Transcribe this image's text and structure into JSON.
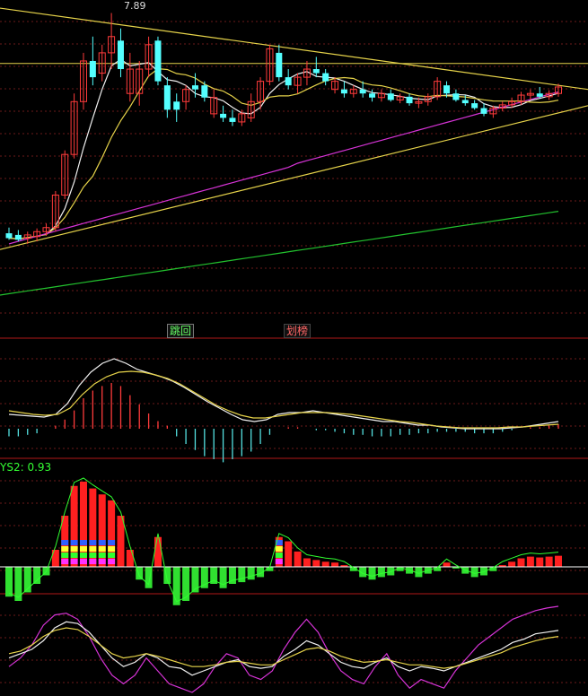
{
  "chart_data": {
    "type": "candlestick",
    "price_label": "7.89",
    "tags": [
      {
        "text": "跳回",
        "color": "#66ff66"
      },
      {
        "text": "划榜",
        "color": "#ff6666"
      }
    ],
    "ys2": {
      "label": "YS2: 0.93",
      "value": 0.93
    },
    "candles": [
      {
        "o": 5.18,
        "h": 5.25,
        "l": 5.1,
        "c": 5.12,
        "up": false
      },
      {
        "o": 5.16,
        "h": 5.22,
        "l": 5.08,
        "c": 5.1,
        "up": false
      },
      {
        "o": 5.12,
        "h": 5.2,
        "l": 5.05,
        "c": 5.16,
        "up": true
      },
      {
        "o": 5.14,
        "h": 5.24,
        "l": 5.08,
        "c": 5.2,
        "up": true
      },
      {
        "o": 5.2,
        "h": 5.3,
        "l": 5.15,
        "c": 5.25,
        "up": true
      },
      {
        "o": 5.25,
        "h": 5.7,
        "l": 5.2,
        "c": 5.65,
        "up": true
      },
      {
        "o": 5.65,
        "h": 6.2,
        "l": 5.6,
        "c": 6.15,
        "up": true
      },
      {
        "o": 6.15,
        "h": 6.9,
        "l": 6.1,
        "c": 6.8,
        "up": true
      },
      {
        "o": 6.8,
        "h": 7.4,
        "l": 6.7,
        "c": 7.3,
        "up": true
      },
      {
        "o": 7.3,
        "h": 7.6,
        "l": 7.0,
        "c": 7.1,
        "up": false
      },
      {
        "o": 7.15,
        "h": 7.5,
        "l": 7.05,
        "c": 7.4,
        "up": true
      },
      {
        "o": 7.4,
        "h": 7.89,
        "l": 7.2,
        "c": 7.6,
        "up": true
      },
      {
        "o": 7.55,
        "h": 7.7,
        "l": 7.1,
        "c": 7.2,
        "up": false
      },
      {
        "o": 7.2,
        "h": 7.4,
        "l": 6.8,
        "c": 6.9,
        "up": true
      },
      {
        "o": 6.9,
        "h": 7.3,
        "l": 6.75,
        "c": 7.2,
        "up": true
      },
      {
        "o": 7.2,
        "h": 7.6,
        "l": 7.1,
        "c": 7.5,
        "up": true
      },
      {
        "o": 7.55,
        "h": 7.6,
        "l": 7.0,
        "c": 7.05,
        "up": false
      },
      {
        "o": 7.0,
        "h": 7.1,
        "l": 6.6,
        "c": 6.7,
        "up": false
      },
      {
        "o": 6.7,
        "h": 6.9,
        "l": 6.55,
        "c": 6.8,
        "up": false
      },
      {
        "o": 6.8,
        "h": 7.0,
        "l": 6.7,
        "c": 6.95,
        "up": true
      },
      {
        "o": 6.95,
        "h": 7.15,
        "l": 6.85,
        "c": 7.0,
        "up": false
      },
      {
        "o": 7.0,
        "h": 7.05,
        "l": 6.8,
        "c": 6.85,
        "up": false
      },
      {
        "o": 6.85,
        "h": 6.95,
        "l": 6.6,
        "c": 6.65,
        "up": true
      },
      {
        "o": 6.65,
        "h": 6.75,
        "l": 6.55,
        "c": 6.6,
        "up": false
      },
      {
        "o": 6.6,
        "h": 6.7,
        "l": 6.5,
        "c": 6.55,
        "up": false
      },
      {
        "o": 6.55,
        "h": 6.7,
        "l": 6.5,
        "c": 6.65,
        "up": true
      },
      {
        "o": 6.6,
        "h": 6.9,
        "l": 6.55,
        "c": 6.8,
        "up": true
      },
      {
        "o": 6.8,
        "h": 7.1,
        "l": 6.7,
        "c": 7.05,
        "up": true
      },
      {
        "o": 7.05,
        "h": 7.5,
        "l": 7.0,
        "c": 7.45,
        "up": true
      },
      {
        "o": 7.4,
        "h": 7.5,
        "l": 7.05,
        "c": 7.1,
        "up": false
      },
      {
        "o": 7.1,
        "h": 7.2,
        "l": 6.95,
        "c": 7.0,
        "up": false
      },
      {
        "o": 7.0,
        "h": 7.15,
        "l": 6.9,
        "c": 7.1,
        "up": true
      },
      {
        "o": 7.1,
        "h": 7.3,
        "l": 7.0,
        "c": 7.2,
        "up": true
      },
      {
        "o": 7.2,
        "h": 7.35,
        "l": 7.1,
        "c": 7.15,
        "up": false
      },
      {
        "o": 7.15,
        "h": 7.2,
        "l": 7.0,
        "c": 7.05,
        "up": false
      },
      {
        "o": 7.05,
        "h": 7.1,
        "l": 6.9,
        "c": 6.95,
        "up": true
      },
      {
        "o": 6.95,
        "h": 7.05,
        "l": 6.85,
        "c": 6.9,
        "up": false
      },
      {
        "o": 6.9,
        "h": 7.0,
        "l": 6.85,
        "c": 6.95,
        "up": true
      },
      {
        "o": 6.95,
        "h": 7.05,
        "l": 6.85,
        "c": 6.9,
        "up": false
      },
      {
        "o": 6.9,
        "h": 6.95,
        "l": 6.8,
        "c": 6.85,
        "up": false
      },
      {
        "o": 6.85,
        "h": 6.95,
        "l": 6.8,
        "c": 6.9,
        "up": true
      },
      {
        "o": 6.9,
        "h": 6.95,
        "l": 6.8,
        "c": 6.82,
        "up": false
      },
      {
        "o": 6.82,
        "h": 6.9,
        "l": 6.78,
        "c": 6.86,
        "up": true
      },
      {
        "o": 6.86,
        "h": 6.9,
        "l": 6.75,
        "c": 6.78,
        "up": false
      },
      {
        "o": 6.78,
        "h": 6.85,
        "l": 6.72,
        "c": 6.8,
        "up": true
      },
      {
        "o": 6.8,
        "h": 6.9,
        "l": 6.75,
        "c": 6.86,
        "up": true
      },
      {
        "o": 6.86,
        "h": 7.1,
        "l": 6.82,
        "c": 7.05,
        "up": true
      },
      {
        "o": 7.0,
        "h": 7.05,
        "l": 6.85,
        "c": 6.9,
        "up": false
      },
      {
        "o": 6.9,
        "h": 6.95,
        "l": 6.8,
        "c": 6.82,
        "up": false
      },
      {
        "o": 6.82,
        "h": 6.88,
        "l": 6.75,
        "c": 6.78,
        "up": false
      },
      {
        "o": 6.78,
        "h": 6.82,
        "l": 6.7,
        "c": 6.72,
        "up": false
      },
      {
        "o": 6.72,
        "h": 6.78,
        "l": 6.62,
        "c": 6.65,
        "up": false
      },
      {
        "o": 6.65,
        "h": 6.75,
        "l": 6.6,
        "c": 6.72,
        "up": true
      },
      {
        "o": 6.72,
        "h": 6.8,
        "l": 6.68,
        "c": 6.76,
        "up": true
      },
      {
        "o": 6.76,
        "h": 6.85,
        "l": 6.72,
        "c": 6.8,
        "up": true
      },
      {
        "o": 6.8,
        "h": 6.92,
        "l": 6.76,
        "c": 6.88,
        "up": true
      },
      {
        "o": 6.88,
        "h": 6.95,
        "l": 6.82,
        "c": 6.9,
        "up": true
      },
      {
        "o": 6.9,
        "h": 6.98,
        "l": 6.84,
        "c": 6.86,
        "up": false
      },
      {
        "o": 6.86,
        "h": 6.94,
        "l": 6.82,
        "c": 6.9,
        "up": true
      },
      {
        "o": 6.9,
        "h": 7.02,
        "l": 6.86,
        "c": 6.98,
        "up": true
      }
    ],
    "macd_hist": [
      -0.05,
      -0.05,
      -0.04,
      -0.03,
      0,
      0.02,
      0.06,
      0.12,
      0.2,
      0.25,
      0.28,
      0.3,
      0.28,
      0.22,
      0.16,
      0.1,
      0.05,
      0.02,
      -0.05,
      -0.1,
      -0.14,
      -0.18,
      -0.2,
      -0.22,
      -0.2,
      -0.18,
      -0.15,
      -0.1,
      -0.04,
      0,
      0.01,
      0.01,
      0,
      -0.01,
      -0.01,
      -0.02,
      -0.03,
      -0.04,
      -0.04,
      -0.05,
      -0.05,
      -0.05,
      -0.04,
      -0.04,
      -0.03,
      -0.03,
      -0.02,
      -0.02,
      -0.02,
      -0.02,
      -0.03,
      -0.03,
      -0.03,
      -0.02,
      -0.01,
      0,
      0.01,
      0.01,
      0.02,
      0.03
    ],
    "ys2_bars": [
      -0.35,
      -0.4,
      -0.3,
      -0.2,
      -0.1,
      0.2,
      0.6,
      0.95,
      1.0,
      0.92,
      0.85,
      0.78,
      0.6,
      0.2,
      -0.15,
      -0.25,
      0.35,
      -0.2,
      -0.45,
      -0.4,
      -0.3,
      -0.25,
      -0.2,
      -0.25,
      -0.2,
      -0.18,
      -0.15,
      -0.12,
      -0.05,
      0.35,
      0.3,
      0.18,
      0.1,
      0.08,
      0.06,
      0.05,
      0.02,
      -0.05,
      -0.12,
      -0.15,
      -0.12,
      -0.1,
      -0.05,
      -0.08,
      -0.12,
      -0.08,
      -0.05,
      0.05,
      -0.02,
      -0.08,
      -0.12,
      -0.1,
      -0.05,
      0.02,
      0.06,
      0.1,
      0.12,
      0.11,
      0.12,
      0.13
    ],
    "ys2_stack": [
      0,
      0,
      0,
      0,
      0,
      0,
      1,
      1,
      1,
      1,
      1,
      1,
      0,
      0,
      0,
      0,
      0,
      0,
      0,
      0,
      0,
      0,
      0,
      0,
      0,
      0,
      0,
      0,
      0,
      1,
      0,
      0,
      0,
      0,
      0,
      0,
      0,
      0,
      0,
      0,
      0,
      0,
      0,
      0,
      0,
      0,
      0,
      0,
      0,
      0,
      0,
      0,
      0,
      0,
      0,
      0,
      0,
      0,
      0,
      0
    ],
    "kdj": {
      "k": [
        40,
        45,
        50,
        60,
        75,
        82,
        80,
        70,
        55,
        40,
        30,
        35,
        45,
        40,
        30,
        28,
        20,
        25,
        30,
        35,
        38,
        30,
        28,
        30,
        42,
        50,
        60,
        55,
        45,
        35,
        30,
        28,
        35,
        40,
        30,
        25,
        30,
        28,
        25,
        30,
        35,
        40,
        45,
        50,
        58,
        62,
        68,
        70,
        72
      ],
      "d": [
        45,
        48,
        55,
        65,
        72,
        75,
        73,
        65,
        55,
        45,
        40,
        42,
        45,
        42,
        38,
        34,
        30,
        30,
        32,
        35,
        36,
        34,
        32,
        32,
        38,
        44,
        50,
        52,
        48,
        42,
        38,
        35,
        36,
        38,
        35,
        32,
        32,
        30,
        28,
        30,
        34,
        38,
        42,
        46,
        52,
        56,
        60,
        63,
        65
      ],
      "j": [
        30,
        40,
        55,
        78,
        90,
        92,
        85,
        65,
        40,
        20,
        10,
        20,
        40,
        25,
        10,
        5,
        0,
        10,
        30,
        45,
        40,
        20,
        15,
        25,
        50,
        70,
        85,
        70,
        45,
        25,
        15,
        10,
        30,
        45,
        20,
        5,
        15,
        10,
        5,
        25,
        40,
        55,
        65,
        75,
        85,
        90,
        95,
        98,
        100
      ]
    }
  }
}
